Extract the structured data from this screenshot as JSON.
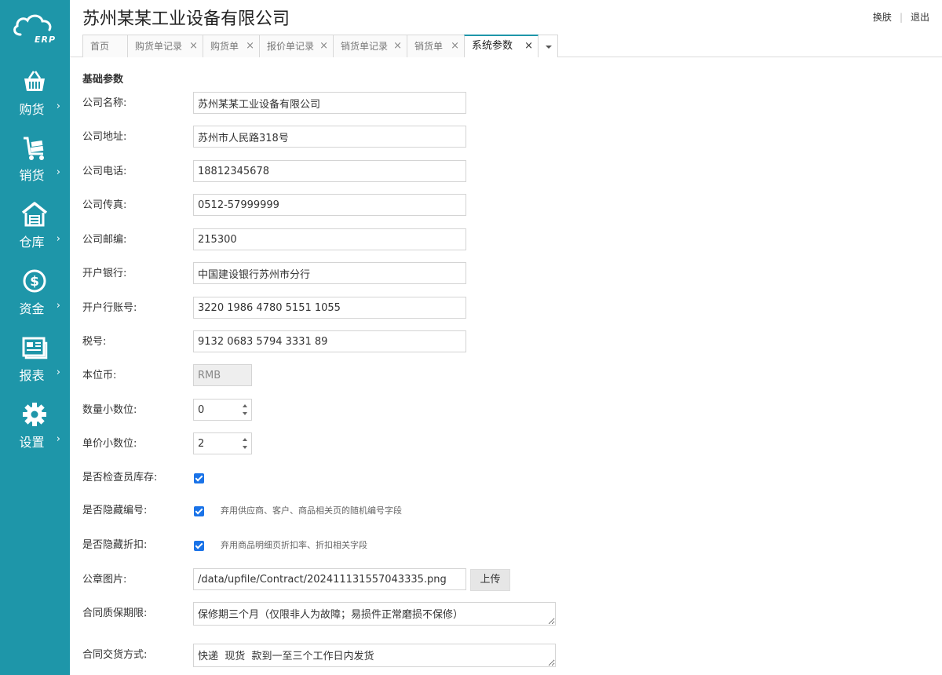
{
  "app": {
    "company_title": "苏州某某工业设备有限公司",
    "logo_text": "ERP"
  },
  "top_links": {
    "skin": "换肤",
    "logout": "退出"
  },
  "nav": [
    {
      "label": "购货",
      "icon": "basket-icon"
    },
    {
      "label": "销货",
      "icon": "cart-icon"
    },
    {
      "label": "仓库",
      "icon": "warehouse-icon"
    },
    {
      "label": "资金",
      "icon": "dollar-icon"
    },
    {
      "label": "报表",
      "icon": "report-icon"
    },
    {
      "label": "设置",
      "icon": "gear-icon"
    }
  ],
  "nav_arrow": "›",
  "tabs": [
    {
      "label": "首页",
      "closable": false
    },
    {
      "label": "购货单记录",
      "closable": true
    },
    {
      "label": "购货单",
      "closable": true
    },
    {
      "label": "报价单记录",
      "closable": true
    },
    {
      "label": "销货单记录",
      "closable": true
    },
    {
      "label": "销货单",
      "closable": true
    },
    {
      "label": "系统参数",
      "closable": true,
      "active": true
    }
  ],
  "tab_close_glyph": "×",
  "form": {
    "section_title": "基础参数",
    "company_name": {
      "label": "公司名称:",
      "value": "苏州某某工业设备有限公司"
    },
    "company_address": {
      "label": "公司地址:",
      "value": "苏州市人民路318号"
    },
    "company_phone": {
      "label": "公司电话:",
      "value": "18812345678"
    },
    "company_fax": {
      "label": "公司传真:",
      "value": "0512-57999999"
    },
    "company_zip": {
      "label": "公司邮编:",
      "value": "215300"
    },
    "bank": {
      "label": "开户银行:",
      "value": "中国建设银行苏州市分行"
    },
    "bank_account": {
      "label": "开户行账号:",
      "value": "3220 1986 4780 5151 1055"
    },
    "tax_id": {
      "label": "税号:",
      "value": "9132 0683 5794 3331 89"
    },
    "currency": {
      "label": "本位币:",
      "value": "RMB"
    },
    "qty_decimals": {
      "label": "数量小数位:",
      "value": "0"
    },
    "price_decimals": {
      "label": "单价小数位:",
      "value": "2"
    },
    "check_stock": {
      "label": "是否检查员库存:",
      "checked": true
    },
    "hide_code": {
      "label": "是否隐藏编号:",
      "checked": true,
      "hint": "弃用供应商、客户、商品相关页的随机编号字段"
    },
    "hide_discount": {
      "label": "是否隐藏折扣:",
      "checked": true,
      "hint": "弃用商品明细页折扣率、折扣相关字段"
    },
    "seal_image": {
      "label": "公章图片:",
      "value": "/data/upfile/Contract/202411131557043335.png",
      "button": "上传"
    },
    "warranty": {
      "label": "合同质保期限:",
      "value": "保修期三个月（仅限非人为故障；易损件正常磨损不保修）"
    },
    "delivery": {
      "label": "合同交货方式:",
      "value": "快递  现货  款到一至三个工作日内发货"
    }
  },
  "colors": {
    "sidebar": "#1e96a9",
    "accent": "#1e96a9",
    "checkbox": "#1a73e8"
  }
}
